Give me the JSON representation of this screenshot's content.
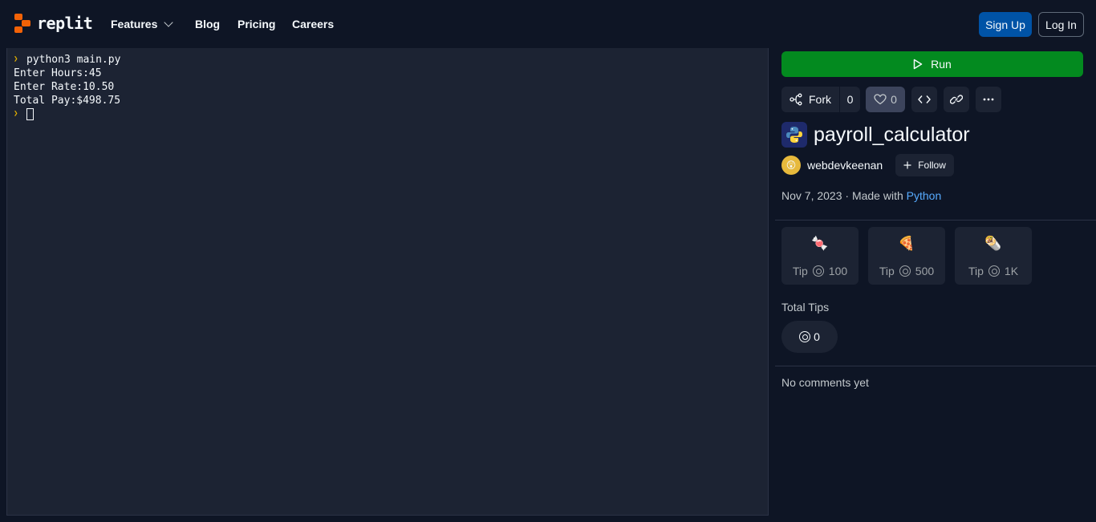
{
  "nav": {
    "logo_text": "replit",
    "items": [
      "Features",
      "Blog",
      "Pricing",
      "Careers"
    ],
    "signup": "Sign Up",
    "login": "Log In"
  },
  "console": {
    "lines": [
      {
        "prompt": true,
        "text": "python3 main.py"
      },
      {
        "prompt": false,
        "text": "Enter Hours:45"
      },
      {
        "prompt": false,
        "text": "Enter Rate:10.50"
      },
      {
        "prompt": false,
        "text": "Total Pay:$498.75"
      }
    ]
  },
  "panel": {
    "run_label": "Run",
    "fork_label": "Fork",
    "fork_count": "0",
    "like_count": "0",
    "title": "payroll_calculator",
    "author": "webdevkeenan",
    "follow_label": "Follow",
    "date": "Nov 7, 2023",
    "made_with": "· Made with",
    "language": "Python",
    "tips": [
      {
        "emoji": "🍬",
        "label": "Tip",
        "amount": "100"
      },
      {
        "emoji": "🍕",
        "label": "Tip",
        "amount": "500"
      },
      {
        "emoji": "🌯",
        "label": "Tip",
        "amount": "1K"
      }
    ],
    "total_tips_label": "Total Tips",
    "total_tips": "0",
    "comments": "No comments yet"
  },
  "colors": {
    "background": "#0e1525",
    "surface": "#1c2333",
    "run_green": "#038a1f",
    "signup_blue": "#0053a6",
    "link_blue": "#57abff",
    "logo_orange": "#f26207"
  }
}
